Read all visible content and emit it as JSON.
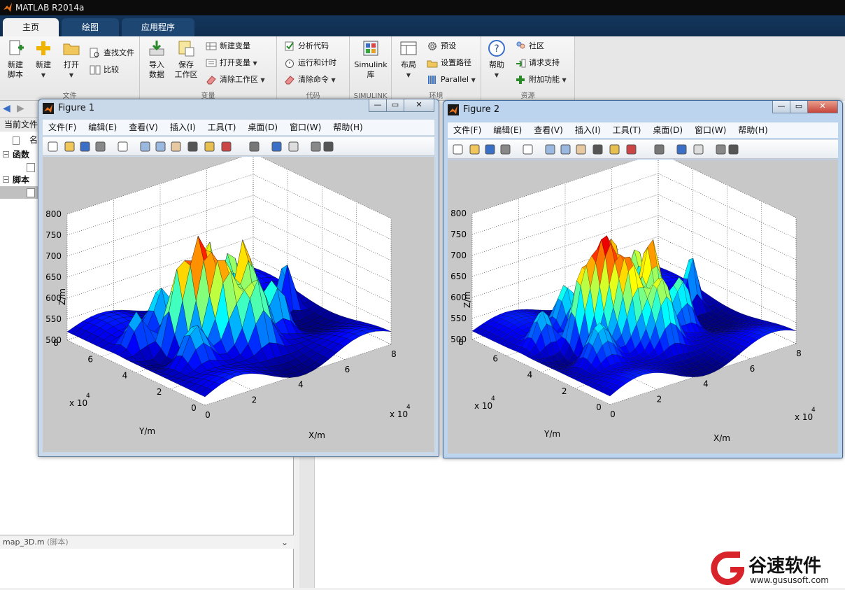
{
  "app": {
    "title": "MATLAB R2014a"
  },
  "tabs": [
    "主页",
    "绘图",
    "应用程序"
  ],
  "ribbon": {
    "file": {
      "label": "文件",
      "new_script": "新建\n脚本",
      "new": "新建",
      "open": "打开",
      "find_files": "查找文件",
      "compare": "比较"
    },
    "variable": {
      "label": "变量",
      "import": "导入\n数据",
      "save": "保存\n工作区",
      "new_var": "新建变量",
      "open_var": "打开变量",
      "clear_ws": "清除工作区"
    },
    "code": {
      "label": "代码",
      "analyze": "分析代码",
      "run_time": "运行和计时",
      "clear_cmd": "清除命令"
    },
    "simulink": {
      "label": "SIMULINK",
      "lib": "Simulink\n库"
    },
    "env": {
      "label": "环境",
      "layout": "布局",
      "prefs": "预设",
      "setpath": "设置路径",
      "parallel": "Parallel"
    },
    "resources": {
      "label": "资源",
      "help": "帮助",
      "community": "社区",
      "support": "请求支持",
      "addons": "附加功能"
    }
  },
  "left_panel": {
    "current_folder": "当前文件",
    "name_col": "名",
    "tree": [
      "函数",
      "脚本"
    ],
    "detail_file": "map_3D.m",
    "detail_type": "(脚本)"
  },
  "figures": [
    {
      "title": "Figure 1",
      "menu": [
        "文件(F)",
        "编辑(E)",
        "查看(V)",
        "插入(I)",
        "工具(T)",
        "桌面(D)",
        "窗口(W)",
        "帮助(H)"
      ],
      "zlabel": "Z/m",
      "xlabel": "X/m",
      "ylabel": "Y/m",
      "zticks": [
        "800",
        "750",
        "700",
        "650",
        "600",
        "550",
        "500"
      ],
      "xticks": [
        "0",
        "2",
        "4",
        "6",
        "8"
      ],
      "yticks": [
        "0",
        "2",
        "4",
        "6",
        "8"
      ],
      "x_exp": "x 10",
      "y_exp": "x 10",
      "exp": "4"
    },
    {
      "title": "Figure 2",
      "menu": [
        "文件(F)",
        "编辑(E)",
        "查看(V)",
        "插入(I)",
        "工具(T)",
        "桌面(D)",
        "窗口(W)",
        "帮助(H)"
      ],
      "zlabel": "Z/m",
      "xlabel": "X/m",
      "ylabel": "Y/m",
      "zticks": [
        "800",
        "750",
        "700",
        "650",
        "600",
        "550",
        "500"
      ],
      "xticks": [
        "0",
        "2",
        "4",
        "6",
        "8"
      ],
      "yticks": [
        "0",
        "2",
        "4",
        "6",
        "8"
      ],
      "x_exp": "x 10",
      "y_exp": "x 10",
      "exp": "4"
    }
  ],
  "watermark": {
    "brand": "谷速软件",
    "url": "www.gususoft.com"
  },
  "colors": {
    "accent": "#0f2d4f",
    "tab_active": "#f2f2f2",
    "plot_bg": "#c8c8c8",
    "brand_red": "#d8232a"
  }
}
